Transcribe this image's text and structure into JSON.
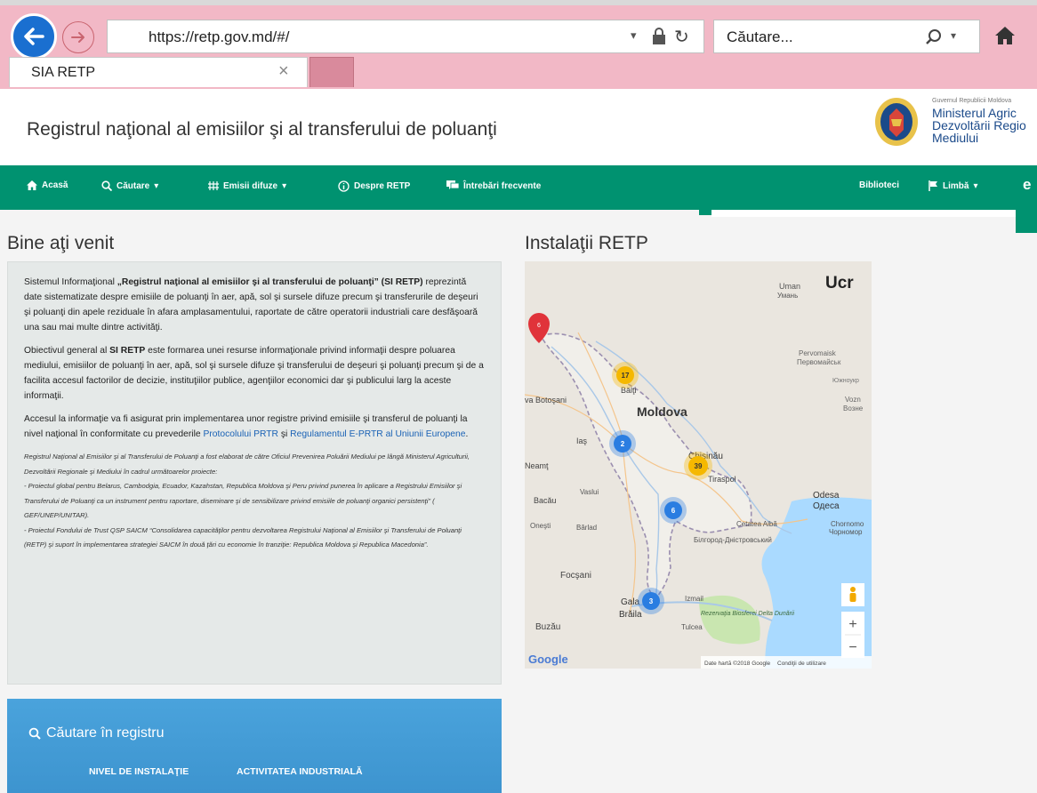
{
  "browser": {
    "url": "https://retp.gov.md/#/",
    "search_placeholder": "Căutare...",
    "tab_title": "SIA RETP",
    "tab_close": "×"
  },
  "header": {
    "title": "Registrul naţional al emisiilor şi al transferului de poluanţi",
    "ministry_small": "Guvernul Republicii Moldova",
    "ministry_line1": "Ministerul Agric",
    "ministry_line2": "Dezvoltării Regio",
    "ministry_line3": "Mediului"
  },
  "nav": {
    "home": "Acasă",
    "search": "Căutare",
    "diffuse": "Emisii difuze",
    "about": "Despre RETP",
    "faq": "Întrebări frecvente",
    "library": "Biblioteci",
    "language": "Limbă",
    "caret": "▾"
  },
  "welcome": {
    "title": "Bine aţi venit",
    "p1_start": "Sistemul Informaţional ",
    "p1_bold": "„Registrul naţional al emisiilor şi al transferului de poluanţi” (SI RETP)",
    "p1_rest": " reprezintă date sistematizate despre emisiile de poluanţi în aer, apă, sol şi sursele difuze precum şi transferurile de deşeuri şi poluanţi din apele reziduale în afara amplasamentului, raportate de către operatorii industriali care desfăşoară una sau mai multe dintre activităţi.",
    "p2_start": "Obiectivul general al ",
    "p2_bold": "SI RETP",
    "p2_rest": " este formarea unei resurse informaţionale privind informaţii despre poluarea mediului, emisiilor de poluanţi în aer, apă, sol şi sursele difuze şi transferului de deşeuri şi poluanţi precum şi de a facilita accesul factorilor de decizie, instituţiilor publice, agenţiilor economici dar şi publicului larg la aceste informaţii.",
    "p3_start": "Accesul la informaţie va fi asigurat prin implementarea unor registre privind emisiile şi transferul de poluanţi la nivel naţional în conformitate cu prevederile ",
    "p3_link1": "Protocolului PRTR",
    "p3_mid": " şi ",
    "p3_link2": "Regulamentul E-PRTR al Uniunii Europene",
    "p3_end": ".",
    "note1": "Registrul Naţional al Emisiilor şi al Transferului de Poluanţi a fost elaborat de către Oficiul Prevenirea Poluării Mediului pe lângă Ministerul Agriculturii, Dezvoltării Regionale şi Mediului în cadrul următoarelor proiecte:",
    "note2": "- Proiectul global pentru Belarus, Cambodgia, Ecuador, Kazahstan, Republica Moldova şi Peru privind punerea în aplicare a Registrului Emisiilor şi Transferului de Poluanţi ca un instrument pentru raportare, diseminare şi de sensibilizare privind emisiile de poluanţi organici persistenţi” ( GEF/UNEP/UNITAR).",
    "note3": "- Proiectul Fondului de Trust QSP SAICM “Consolidarea capacităţilor pentru dezvoltarea Registrului Naţional al Emisiilor şi Transferului de Poluanţi (RETP) şi suport în implementarea strategiei SAICM în două ţări cu economie în tranziţie: Republica Moldova şi Republica Macedonia”."
  },
  "map": {
    "title": "Instalaţii RETP",
    "labels": {
      "ucr": "Ucr",
      "uman": "Uman",
      "uman_cyr": "Умань",
      "moldova": "Moldova",
      "balti": "Bălţi",
      "botosani": "va Botoşani",
      "chisinau": "Chişinău",
      "tiraspol": "Tiraspol",
      "bacau": "Bacău",
      "vaslui": "Vaslui",
      "odesa": "Odesa",
      "odesa_cyr": "Одеса",
      "focsani": "Focşani",
      "galati": "Gala",
      "braila": "Brăila",
      "buzau": "Buzău",
      "tulcea": "Tulcea",
      "ismail": "Izmail",
      "pervomaisk": "Pervomaisk",
      "pervomaisk_cyr": "Первомайськ",
      "voznesensk": "Vozn",
      "voznesensk_cyr": "Возне",
      "cetatea_alba": "Cetatea Albă",
      "belgorod": "Білгород-Дністровський",
      "onesti": "Oneşti",
      "barlad": "Bârlad",
      "neamt": "Neamţ",
      "reserve": "Rezervaţia Biosferei Delta Dunării",
      "chornomorsk": "Chornomo",
      "chornomorsk_cyr": "Чорномор",
      "yuzhnoukr": "Южноукр",
      "iasi": "Iaş"
    },
    "clusters": [
      {
        "count": "17",
        "color": "#f5b800"
      },
      {
        "count": "2",
        "color": "#2a7de1"
      },
      {
        "count": "39",
        "color": "#f5b800"
      },
      {
        "count": "6",
        "color": "#2a7de1"
      },
      {
        "count": "3",
        "color": "#2a7de1"
      }
    ],
    "pin_count": "6",
    "google": "Google",
    "attribution": "Date hartă ©2018 Google",
    "terms": "Condiţii de utilizare",
    "zoom_in": "+",
    "zoom_out": "−"
  },
  "search_panel": {
    "title": "Căutare în registru",
    "btn_installation": "NIVEL DE INSTALAŢIE",
    "btn_activity": "ACTIVITATEA INDUSTRIALĂ"
  },
  "colors": {
    "nav_green": "#009270",
    "chrome_pink": "#f2b8c6",
    "panel_blue": "#4aa3dc",
    "link_blue": "#1a62b5"
  }
}
